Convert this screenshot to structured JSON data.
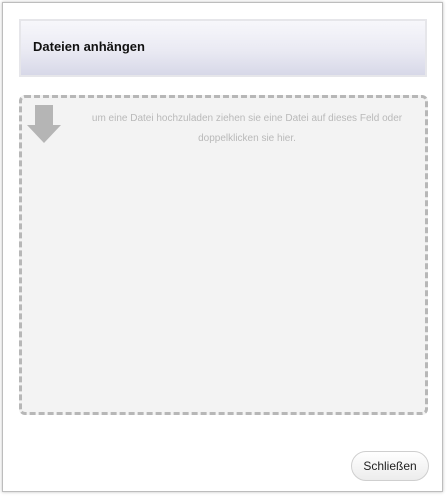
{
  "dialog": {
    "title": "Dateien anhängen",
    "dropzone": {
      "icon": "down-arrow-icon",
      "hint": "um eine Datei hochzuladen ziehen sie eine Datei auf dieses Feld oder doppelklicken sie hier."
    },
    "close_label": "Schließen"
  },
  "colors": {
    "header_gradient_top": "#f7f7fb",
    "header_gradient_bottom": "#d7d8e8",
    "dropzone_background": "#f3f3f3",
    "dropzone_border": "#b7b7b7",
    "hint_text": "#b9b9b9"
  }
}
